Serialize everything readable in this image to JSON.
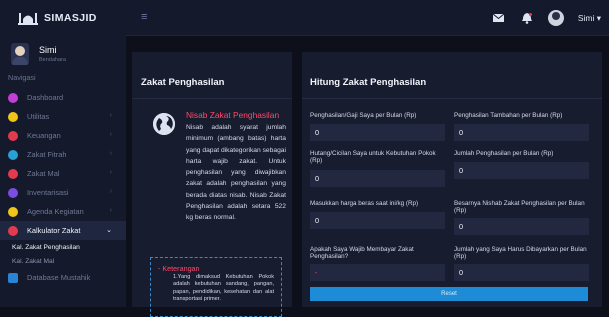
{
  "brand": {
    "name": "SIMASJID"
  },
  "topbar": {
    "menu_icon": "hamburger-icon",
    "username": "Simi",
    "caret": "▾"
  },
  "sidebar": {
    "user": {
      "name": "Simi",
      "status": "Bendahara"
    },
    "nav_title": "Navigasi",
    "items": [
      {
        "label": "Dashboard",
        "icon": "dashboard-icon",
        "color": "#c23fd6"
      },
      {
        "label": "Utilitas",
        "icon": "utilities-icon",
        "color": "#f0c419"
      },
      {
        "label": "Keuangan",
        "icon": "finance-icon",
        "color": "#e23b4d"
      },
      {
        "label": "Zakat Fitrah",
        "icon": "zakat-fitrah-icon",
        "color": "#2aa0d6"
      },
      {
        "label": "Zakat Mal",
        "icon": "zakat-mal-icon",
        "color": "#e23b4d"
      },
      {
        "label": "Inventarisasi",
        "icon": "inventory-icon",
        "color": "#7b4de0"
      },
      {
        "label": "Agenda Kegiatan",
        "icon": "calendar-icon",
        "color": "#f0c419"
      },
      {
        "label": "Kalkulator Zakat",
        "icon": "calculator-icon",
        "color": "#e23b4d"
      }
    ],
    "subitems": [
      "Kal. Zakat Penghasilan",
      "Kal. Zakat Mal"
    ],
    "last": {
      "label": "Database Mustahik",
      "icon": "database-icon",
      "color": "#2a84d6"
    }
  },
  "card_left": {
    "title": "Zakat Penghasilan",
    "nisab_title": "Nisab Zakat Penghasilan",
    "nisab_text": "Nisab adalah syarat jumlah minimum (ambang batas) harta yang dapat dikategorikan sebagai harta wajib zakat. Untuk penghasilan yang diwajibkan zakat adalah penghasilan yang berada diatas nisab. Nisab Zakat Penghasilan adalah setara 522 kg beras normal.",
    "keterangan_title": "- Keterangan",
    "keterangan_text": "1.Yang dimaksud Kebutuhan Pokok adalah kebutuhan sandang, pangan, papan, pendidikan, kesehatan dan alat transportasi primer."
  },
  "card_right": {
    "title": "Hitung Zakat Penghasilan",
    "fields": [
      {
        "label": "Penghasilan/Gaji Saya per Bulan (Rp)",
        "value": "0"
      },
      {
        "label": "Penghasilan Tambahan per Bulan (Rp)",
        "value": "0"
      },
      {
        "label": "Hutang/Cicilan Saya untuk Kebutuhan Pokok (Rp)",
        "value": "0"
      },
      {
        "label": "Jumlah Penghasilan per Bulan (Rp)",
        "value": "0"
      },
      {
        "label": "Masukkan harga beras saat ini/kg (Rp)",
        "value": "0"
      },
      {
        "label": "Besarnya Nishab Zakat Penghasilan per Bulan (Rp)",
        "value": "0"
      },
      {
        "label": "Apakah Saya Wajib Membayar Zakat Penghasilan?",
        "value": "-"
      },
      {
        "label": "Jumlah yang Saya Harus Dibayarkan per Bulan (Rp)",
        "value": "0"
      }
    ],
    "reset_label": "Reset"
  }
}
